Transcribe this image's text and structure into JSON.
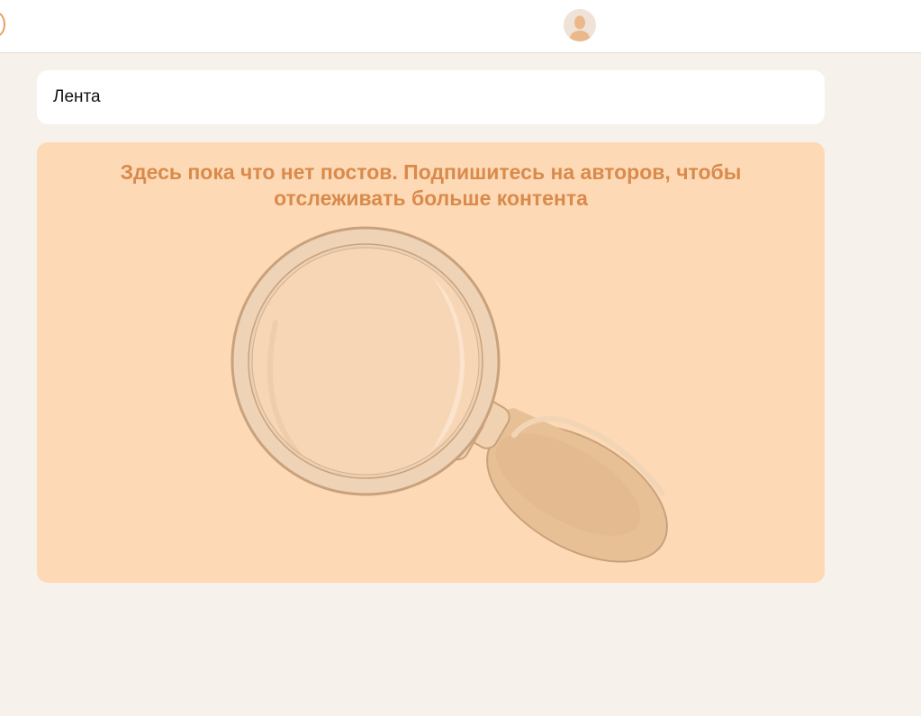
{
  "header": {
    "logo_icon": "logo-partial-icon",
    "avatar_icon": "user-avatar-icon"
  },
  "feed": {
    "title": "Лента"
  },
  "empty_state": {
    "message": "Здесь пока что нет постов. Подпишитесь на авторов, чтобы отслеживать больше контента",
    "illustration_icon": "magnifying-glass-icon"
  },
  "colors": {
    "page_background": "#f6f1eb",
    "card_background": "#fddab5",
    "accent_text": "#d98a4c",
    "logo_accent": "#e8a062"
  }
}
